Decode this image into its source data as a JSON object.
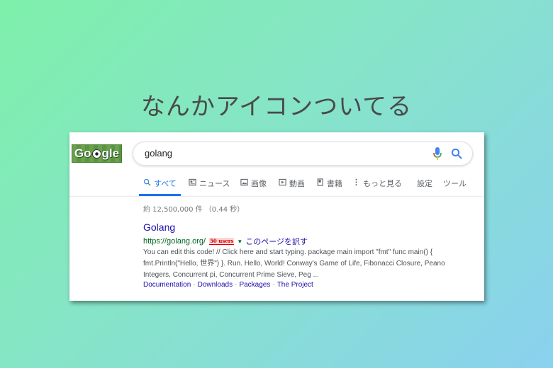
{
  "headline": "なんかアイコンついてる",
  "logo": {
    "text_before": "Go",
    "text_after": "gle",
    "icon": "soccer-ball-icon"
  },
  "search": {
    "query": "golang"
  },
  "tabs": [
    {
      "label": "すべて",
      "icon": "search-icon",
      "active": true
    },
    {
      "label": "ニュース",
      "icon": "news-icon"
    },
    {
      "label": "画像",
      "icon": "image-icon"
    },
    {
      "label": "動画",
      "icon": "video-icon"
    },
    {
      "label": "書籍",
      "icon": "book-icon"
    },
    {
      "label": "もっと見る",
      "icon": "more-icon"
    },
    {
      "label": "設定"
    },
    {
      "label": "ツール"
    }
  ],
  "results_count": "約 12,500,000 件 （0.44 秒）",
  "result": {
    "title": "Golang",
    "url": "https://golang.org/",
    "badge": "50 users",
    "translate": "このページを訳す",
    "snippet": "You can edit this code! // Click here and start typing. package main import \"fmt\" func main() { fmt.Println(\"Hello, 世界\") }. Run. Hello, World! Conway's Game of Life, Fibonacci Closure, Peano Integers, Concurrent pi, Concurrent Prime Sieve, Peg ...",
    "sitelinks": [
      "Documentation",
      "Downloads",
      "Packages",
      "The Project"
    ]
  },
  "colors": {
    "link": "#1a0dab",
    "url": "#006621",
    "accent": "#1a73e8",
    "badge": "#dd0000"
  }
}
